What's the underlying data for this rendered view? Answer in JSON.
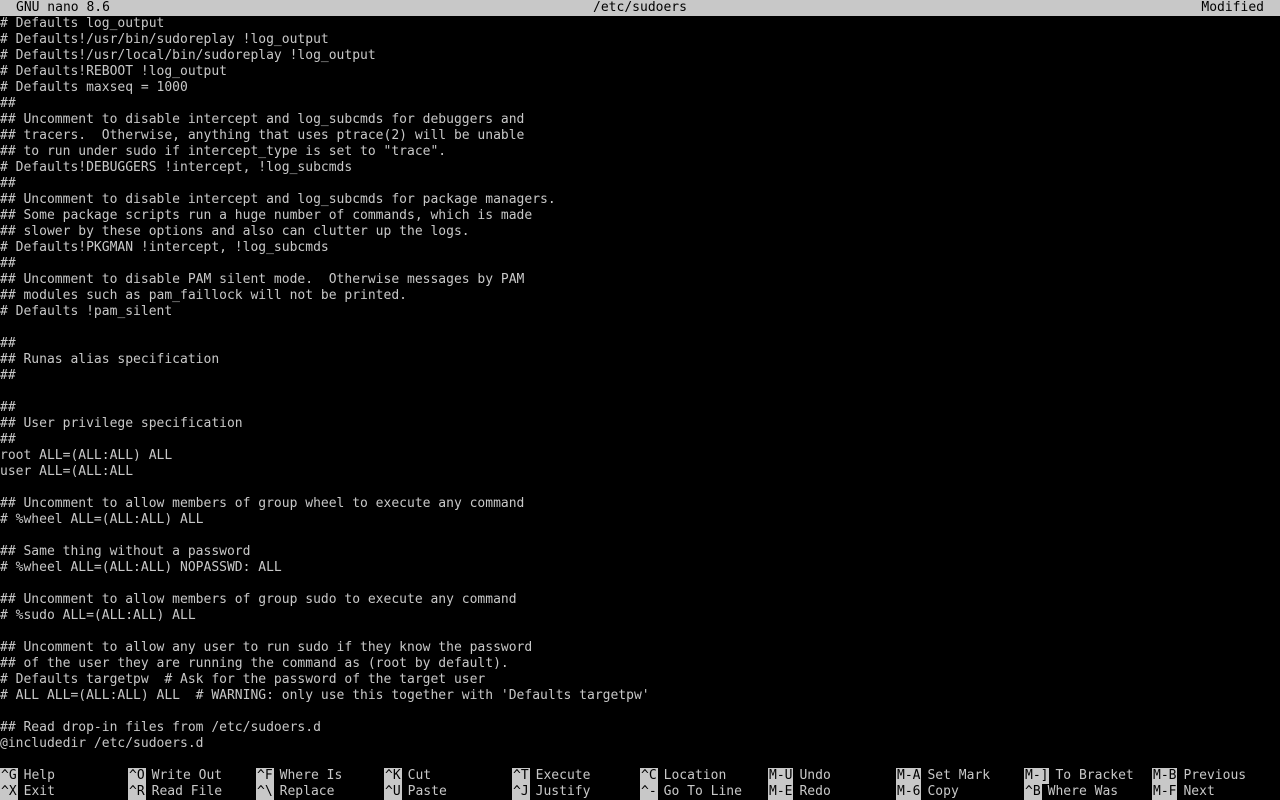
{
  "titlebar": {
    "app": "GNU nano 8.6",
    "file": "/etc/sudoers",
    "state": "Modified"
  },
  "lines": [
    "# Defaults log_output",
    "# Defaults!/usr/bin/sudoreplay !log_output",
    "# Defaults!/usr/local/bin/sudoreplay !log_output",
    "# Defaults!REBOOT !log_output",
    "# Defaults maxseq = 1000",
    "##",
    "## Uncomment to disable intercept and log_subcmds for debuggers and",
    "## tracers.  Otherwise, anything that uses ptrace(2) will be unable",
    "## to run under sudo if intercept_type is set to \"trace\".",
    "# Defaults!DEBUGGERS !intercept, !log_subcmds",
    "##",
    "## Uncomment to disable intercept and log_subcmds for package managers.",
    "## Some package scripts run a huge number of commands, which is made",
    "## slower by these options and also can clutter up the logs.",
    "# Defaults!PKGMAN !intercept, !log_subcmds",
    "##",
    "## Uncomment to disable PAM silent mode.  Otherwise messages by PAM",
    "## modules such as pam_faillock will not be printed.",
    "# Defaults !pam_silent",
    "",
    "##",
    "## Runas alias specification",
    "##",
    "",
    "##",
    "## User privilege specification",
    "##",
    "root ALL=(ALL:ALL) ALL",
    "user ALL=(ALL:ALL",
    "",
    "## Uncomment to allow members of group wheel to execute any command",
    "# %wheel ALL=(ALL:ALL) ALL",
    "",
    "## Same thing without a password",
    "# %wheel ALL=(ALL:ALL) NOPASSWD: ALL",
    "",
    "## Uncomment to allow members of group sudo to execute any command",
    "# %sudo ALL=(ALL:ALL) ALL",
    "",
    "## Uncomment to allow any user to run sudo if they know the password",
    "## of the user they are running the command as (root by default).",
    "# Defaults targetpw  # Ask for the password of the target user",
    "# ALL ALL=(ALL:ALL) ALL  # WARNING: only use this together with 'Defaults targetpw'",
    "",
    "## Read drop-in files from /etc/sudoers.d",
    "@includedir /etc/sudoers.d"
  ],
  "shortcuts": {
    "row1": [
      {
        "key": "^G",
        "label": "Help"
      },
      {
        "key": "^O",
        "label": "Write Out"
      },
      {
        "key": "^F",
        "label": "Where Is"
      },
      {
        "key": "^K",
        "label": "Cut"
      },
      {
        "key": "^T",
        "label": "Execute"
      },
      {
        "key": "^C",
        "label": "Location"
      },
      {
        "key": "M-U",
        "label": "Undo"
      },
      {
        "key": "M-A",
        "label": "Set Mark"
      },
      {
        "key": "M-]",
        "label": "To Bracket"
      },
      {
        "key": "M-B",
        "label": "Previous"
      }
    ],
    "row2": [
      {
        "key": "^X",
        "label": "Exit"
      },
      {
        "key": "^R",
        "label": "Read File"
      },
      {
        "key": "^\\",
        "label": "Replace"
      },
      {
        "key": "^U",
        "label": "Paste"
      },
      {
        "key": "^J",
        "label": "Justify"
      },
      {
        "key": "^-",
        "label": "Go To Line"
      },
      {
        "key": "M-E",
        "label": "Redo"
      },
      {
        "key": "M-6",
        "label": "Copy"
      },
      {
        "key": "^B",
        "label": "Where Was"
      },
      {
        "key": "M-F",
        "label": "Next"
      }
    ]
  },
  "colors": {
    "background": "#000000",
    "foreground": "#c8c8c8",
    "inverse_bg": "#c8c8c8",
    "inverse_fg": "#000000"
  }
}
